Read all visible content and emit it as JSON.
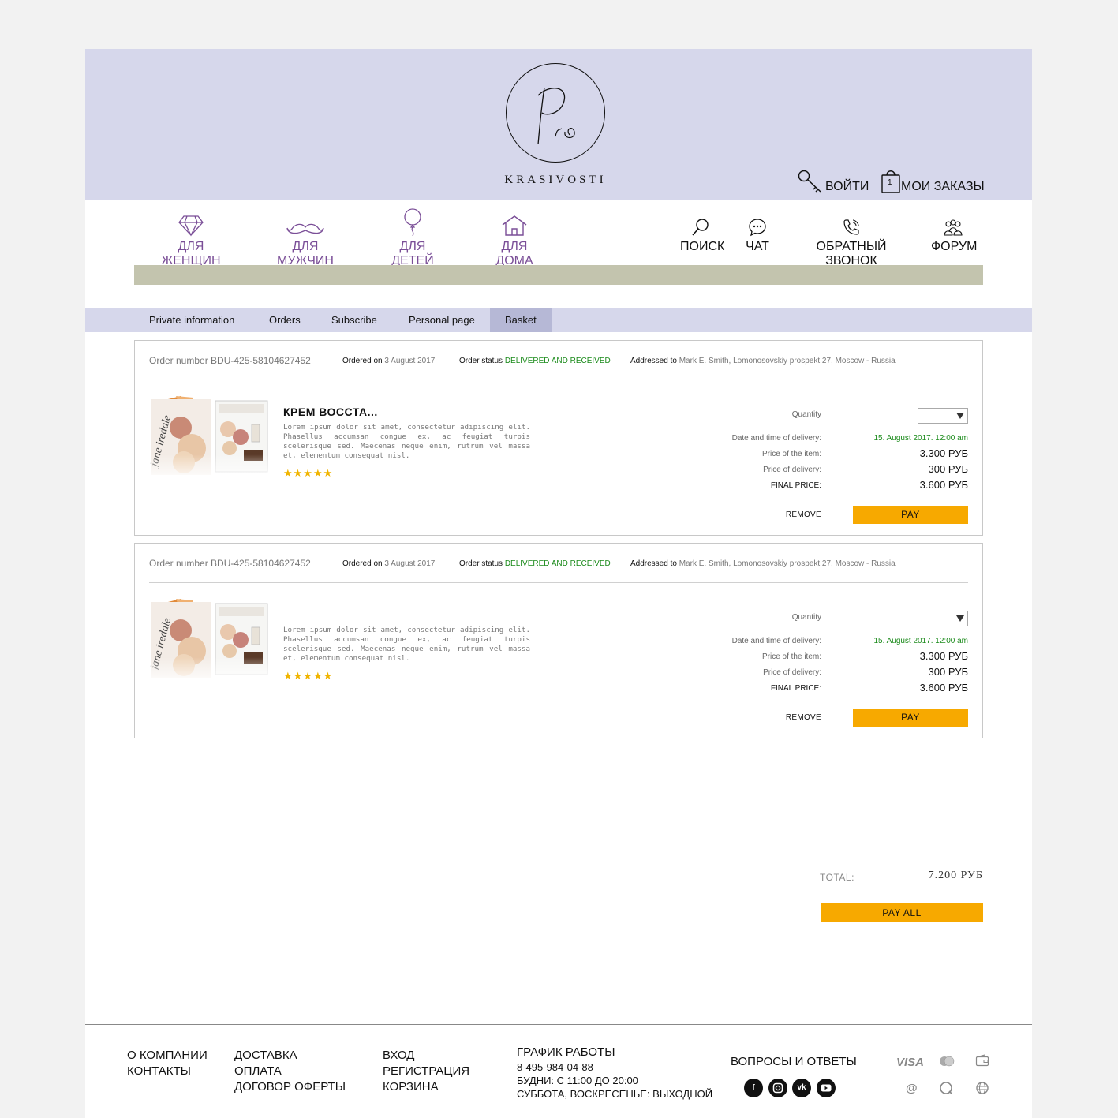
{
  "brand": {
    "logo_letters": "Pro",
    "name": "KRASIVOSTI"
  },
  "header": {
    "login": "ВОЙТИ",
    "orders": "МОИ ЗАКАЗЫ",
    "cart_count": "1"
  },
  "nav": {
    "categories": [
      "ДЛЯ ЖЕНЩИН",
      "ДЛЯ МУЖЧИН",
      "ДЛЯ ДЕТЕЙ",
      "ДЛЯ ДОМА"
    ],
    "tools": [
      "ПОИСК",
      "ЧАТ",
      "ОБРАТНЫЙ ЗВОНОК",
      "ФОРУМ"
    ]
  },
  "tabs": [
    "Private information",
    "Orders",
    "Subscribe",
    "Personal page",
    "Basket"
  ],
  "active_tab": "Basket",
  "orders": [
    {
      "number": "Order number BDU-425-58104627452",
      "ordered_label": "Ordered on",
      "ordered_date": "3 August 2017",
      "status_label": "Order status",
      "status": "DELIVERED AND RECEIVED",
      "addressed_label": "Addressed to",
      "address": "Mark E. Smith, Lomonosovskiy prospekt 27, Moscow - Russia",
      "product_title": "КРЕМ ВОССТА...",
      "description": "Lorem ipsum dolor sit amet, consectetur adipiscing elit. Phasellus accumsan congue ex, ac feugiat turpis scelerisque sed. Maecenas neque enim, rutrum vel massa et, elementum consequat nisl.",
      "rating": "★★★★★",
      "quantity_label": "Quantity",
      "delivery_label": "Date and time of delivery:",
      "delivery_value": "15. August 2017. 12:00 am",
      "price_label": "Price of the item:",
      "price_value": "3.300 РУБ",
      "delivery_price_label": "Price of delivery:",
      "delivery_price_value": "300 РУБ",
      "final_label": "FINAL PRICE:",
      "final_value": "3.600 РУБ",
      "remove": "REMOVE",
      "pay": "PAY"
    },
    {
      "number": "Order number BDU-425-58104627452",
      "ordered_label": "Ordered on",
      "ordered_date": "3 August 2017",
      "status_label": "Order status",
      "status": "DELIVERED AND RECEIVED",
      "addressed_label": "Addressed to",
      "address": "Mark E. Smith, Lomonosovskiy prospekt 27, Moscow - Russia",
      "product_title": "",
      "description": "Lorem ipsum dolor sit amet, consectetur adipiscing elit. Phasellus accumsan congue ex, ac feugiat turpis scelerisque sed. Maecenas neque enim, rutrum vel massa et, elementum consequat nisl.",
      "rating": "★★★★★",
      "quantity_label": "Quantity",
      "delivery_label": "Date and time of delivery:",
      "delivery_value": "15. August 2017. 12:00 am",
      "price_label": "Price of the item:",
      "price_value": "3.300 РУБ",
      "delivery_price_label": "Price of delivery:",
      "delivery_price_value": "300 РУБ",
      "final_label": "FINAL PRICE:",
      "final_value": "3.600 РУБ",
      "remove": "REMOVE",
      "pay": "PAY"
    }
  ],
  "product_image": {
    "brand_script": "jane iredale"
  },
  "total": {
    "label": "TOTAL:",
    "value": "7.200 РУБ",
    "pay_all": "PAY ALL"
  },
  "footer": {
    "col1": [
      "О КОМПАНИИ",
      "КОНТАКТЫ"
    ],
    "col2": [
      "ДОСТАВКА",
      "ОПЛАТА",
      "ДОГОВОР ОФЕРТЫ"
    ],
    "col3": [
      "ВХОД",
      "РЕГИСТРАЦИЯ",
      "КОРЗИНА"
    ],
    "schedule_title": "ГРАФИК РАБОТЫ",
    "phone": "8-495-984-04-88",
    "weekdays": "БУДНИ: С 11:00 ДО 20:00",
    "weekend": "СУББОТА, ВОСКРЕСЕНЬЕ: ВЫХОДНОЙ",
    "faq": "ВОПРОСЫ И ОТВЕТЫ",
    "social_icons": [
      "facebook-icon",
      "instagram-icon",
      "vk-icon",
      "youtube-icon"
    ],
    "payments": {
      "visa": "VISA",
      "at": "@"
    }
  },
  "colors": {
    "header_bg": "#d6d7eb",
    "accent_purple": "#7a4e97",
    "button": "#f7a900",
    "olive_bar": "#c3c4ae",
    "status_green": "#1a8a1a"
  }
}
